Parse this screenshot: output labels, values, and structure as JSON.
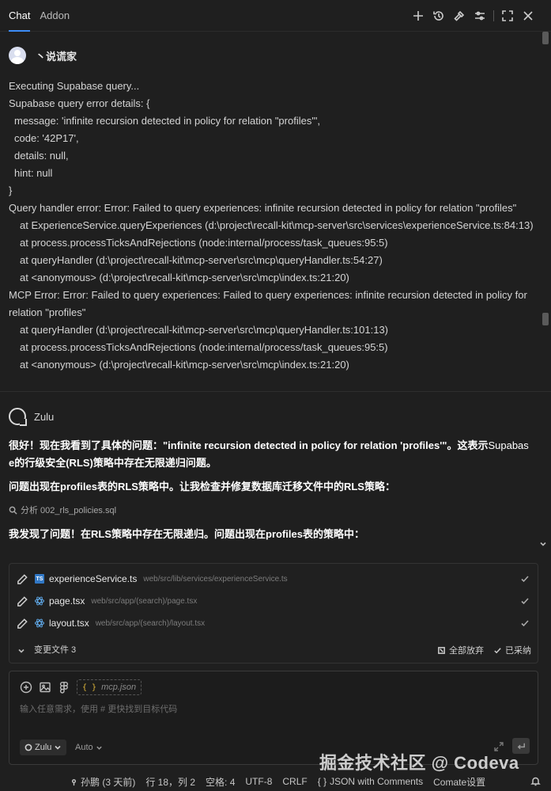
{
  "tabs": [
    {
      "label": "Chat",
      "active": true
    },
    {
      "label": "Addon",
      "active": false
    }
  ],
  "toolbar_icons": [
    "plus-icon",
    "history-icon",
    "hammer-icon",
    "sliders-icon",
    "maximize-icon",
    "close-icon"
  ],
  "user": {
    "name": "丶说谎家"
  },
  "log_lines": [
    {
      "text": "Executing Supabase query...",
      "indent": 0
    },
    {
      "text": "Supabase query error details: {",
      "indent": 0
    },
    {
      "text": "message: 'infinite recursion detected in policy for relation \"profiles\"',",
      "indent": 1
    },
    {
      "text": "code: '42P17',",
      "indent": 1
    },
    {
      "text": "details: null,",
      "indent": 1
    },
    {
      "text": "hint: null",
      "indent": 1
    },
    {
      "text": "}",
      "indent": 0
    },
    {
      "text": "Query handler error: Error: Failed to query experiences: infinite recursion detected in policy for relation \"profiles\"",
      "indent": 0
    },
    {
      "text": "at ExperienceService.queryExperiences (d:\\project\\recall-kit\\mcp-server\\src\\services\\experienceService.ts:84:13)",
      "indent": 2
    },
    {
      "text": "at process.processTicksAndRejections (node:internal/process/task_queues:95:5)",
      "indent": 2
    },
    {
      "text": "at queryHandler (d:\\project\\recall-kit\\mcp-server\\src\\mcp\\queryHandler.ts:54:27)",
      "indent": 2
    },
    {
      "text": "at <anonymous> (d:\\project\\recall-kit\\mcp-server\\src\\mcp\\index.ts:21:20)",
      "indent": 2
    },
    {
      "text": "MCP Error: Error: Failed to query experiences: Failed to query experiences: infinite recursion detected in policy for",
      "indent": 0
    },
    {
      "text": "relation \"profiles\"",
      "indent": 0
    },
    {
      "text": "at queryHandler (d:\\project\\recall-kit\\mcp-server\\src\\mcp\\queryHandler.ts:101:13)",
      "indent": 2
    },
    {
      "text": "at process.processTicksAndRejections (node:internal/process/task_queues:95:5)",
      "indent": 2
    },
    {
      "text": "at <anonymous> (d:\\project\\recall-kit\\mcp-server\\src\\mcp\\index.ts:21:20)",
      "indent": 2
    }
  ],
  "bot": {
    "name": "Zulu"
  },
  "reply": {
    "line1_bold": "很好！现在我看到了具体的问题：\"infinite recursion detected in policy for relation 'profiles'\"。这表示",
    "line1_normal": "Supabas",
    "line2": "e的行级安全(RLS)策略中存在无限递归问题。",
    "line3": "问题出现在profiles表的RLS策略中。让我检查并修复数据库迁移文件中的RLS策略：",
    "analyze": "分析 002_rls_policies.sql",
    "line4": "我发现了问题！在RLS策略中存在无限递归。问题出现在profiles表的策略中："
  },
  "files": [
    {
      "name": "experienceService.ts",
      "path": "web/src/lib/services/experienceService.ts",
      "type": "ts",
      "type_label": "TS"
    },
    {
      "name": "page.tsx",
      "path": "web/src/app/(search)/page.tsx",
      "type": "react"
    },
    {
      "name": "layout.tsx",
      "path": "web/src/app/(search)/layout.tsx",
      "type": "react"
    }
  ],
  "files_footer": {
    "changed_label": "变更文件 3",
    "discard_all": "全部放弃",
    "accepted": "已采纳"
  },
  "input": {
    "mcp_tag": "mcp.json",
    "mcp_brace": "{ }",
    "placeholder": "输入任意需求，使用 # 更快找到目标代码",
    "model": "Zulu",
    "mode": "Auto"
  },
  "watermark": "掘金技术社区 @ Codeva",
  "status": {
    "author": "孙鹏 (3 天前)",
    "position": "行 18，列 2",
    "spaces": "空格: 4",
    "encoding": "UTF-8",
    "eol": "CRLF",
    "language": "JSON with Comments",
    "comate": "Comate设置"
  },
  "colors": {
    "background": "#1f1f1f",
    "accent": "#3d8cf6",
    "ts_icon": "#3178c6",
    "react_icon": "#5fa8e8",
    "mcp_brace": "#e2b93b"
  }
}
